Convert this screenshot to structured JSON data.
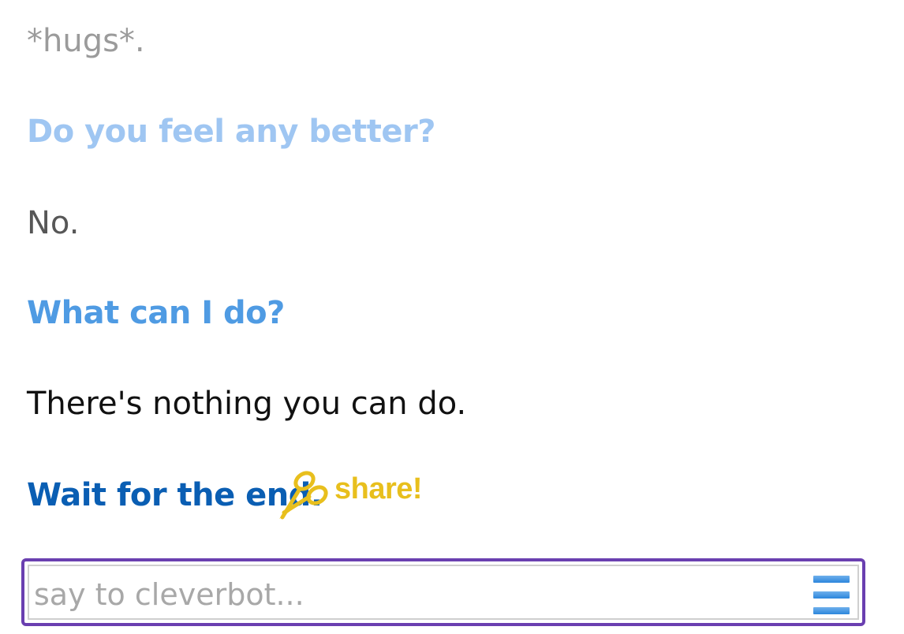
{
  "conversation": [
    {
      "speaker": "bot",
      "text": "*hugs*."
    },
    {
      "speaker": "user",
      "text": "Do you feel any better?"
    },
    {
      "speaker": "bot",
      "text": "No."
    },
    {
      "speaker": "user",
      "text": "What can I do?"
    },
    {
      "speaker": "bot",
      "text": "There's nothing you can do."
    },
    {
      "speaker": "user",
      "text": "Wait for the end."
    }
  ],
  "share": {
    "label": "share!",
    "icon": "scissors-icon",
    "color": "#e8bf1d"
  },
  "input": {
    "placeholder": "say to cleverbot...",
    "value": ""
  },
  "menu": {
    "icon": "hamburger-menu-icon",
    "color": "#2c86dc"
  },
  "colors": {
    "input_border": "#6a3fb0",
    "latest_user_text": "#0a5eb3"
  }
}
